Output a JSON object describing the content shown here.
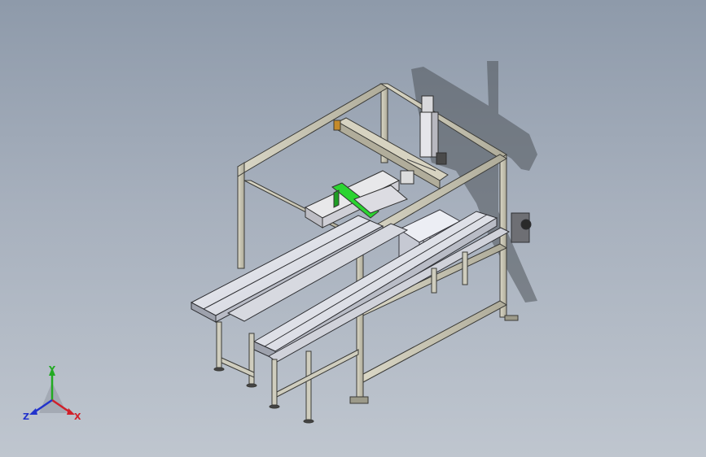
{
  "viewport": {
    "background_top": "#8e9aaa",
    "background_bottom": "#bfc6cf",
    "model_description_icon": "conveyor-gantry-machine-icon"
  },
  "triad": {
    "x_label": "X",
    "y_label": "Y",
    "z_label": "Z",
    "x_color": "#d0202a",
    "y_color": "#22aa22",
    "z_color": "#2233cc"
  },
  "colors": {
    "frame": "#c9c6b4",
    "frame_edge": "#3a3a36",
    "belt": "#e4e6ee",
    "accent_green": "#2bd431",
    "shadow": "#55585e"
  }
}
